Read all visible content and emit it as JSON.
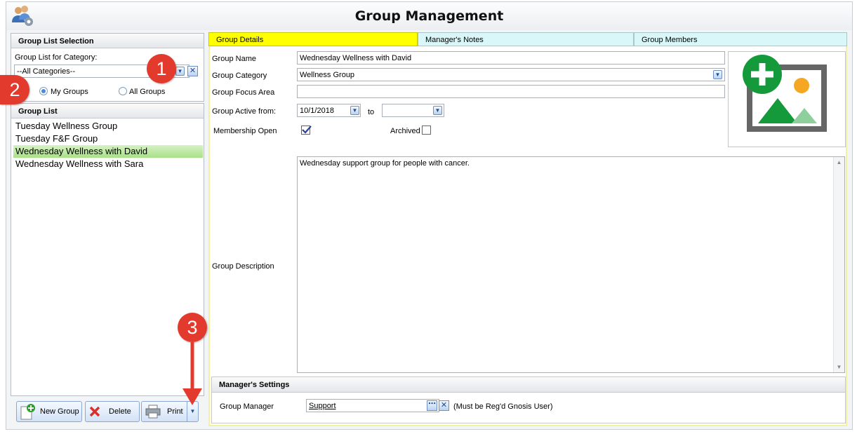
{
  "window": {
    "title": "Group Management"
  },
  "left": {
    "selection_header": "Group List Selection",
    "category_label": "Group List for Category:",
    "category_value": "--All Categories--",
    "radio_my": "My Groups",
    "radio_all": "All Groups",
    "list_header": "Group List",
    "groups": [
      "Tuesday Wellness Group",
      "Tuesday F&F Group",
      "Wednesday Wellness with David",
      "Wednesday Wellness with Sara"
    ],
    "selected_index": 2,
    "buttons": {
      "new": "New Group",
      "delete": "Delete",
      "print": "Print"
    }
  },
  "tabs": [
    "Group Details",
    "Manager's Notes",
    "Group Members"
  ],
  "form": {
    "name_label": "Group Name",
    "name_value": "Wednesday Wellness with David",
    "category_label": "Group Category",
    "category_value": "Wellness Group",
    "focus_label": "Group Focus Area",
    "focus_value": "",
    "active_label": "Group Active from:",
    "active_from": "10/1/2018",
    "to_label": "to",
    "active_to": "",
    "membership_label": "Membership Open",
    "archived_label": "Archived",
    "description_label": "Group Description",
    "description_value": "Wednesday support group for people with cancer."
  },
  "manager": {
    "header": "Manager's Settings",
    "label": "Group Manager",
    "value": "Support",
    "note": "(Must be Reg'd Gnosis User)"
  },
  "callouts": [
    "1",
    "2",
    "3"
  ],
  "colors": {
    "active_tab": "#ffff00",
    "inactive_tab": "#d9f7f9",
    "selected_row": "#b5e49a",
    "callout": "#e33a2e"
  }
}
